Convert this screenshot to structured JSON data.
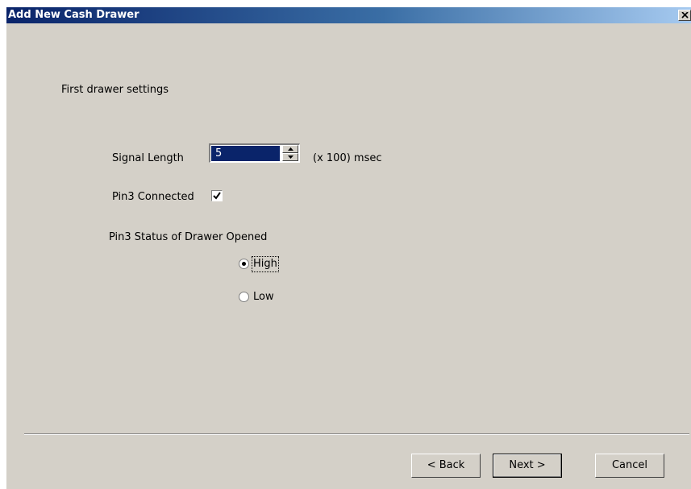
{
  "window": {
    "title": "Add New Cash Drawer",
    "close_glyph": "×"
  },
  "content": {
    "heading": "First drawer settings",
    "signal_length": {
      "label": "Signal Length",
      "value": "5",
      "unit": "(x 100) msec"
    },
    "pin3_connected": {
      "label": "Pin3 Connected",
      "checked": true
    },
    "pin3_status": {
      "label": "Pin3 Status of Drawer Opened",
      "options": [
        {
          "label": "High",
          "selected": true
        },
        {
          "label": "Low",
          "selected": false
        }
      ]
    }
  },
  "footer": {
    "back_label": "< Back",
    "next_label": "Next >",
    "cancel_label": "Cancel"
  },
  "colors": {
    "title_bar": "#0a246a",
    "dialog_background": "#d4d0c8",
    "selection": "#0a246a"
  }
}
